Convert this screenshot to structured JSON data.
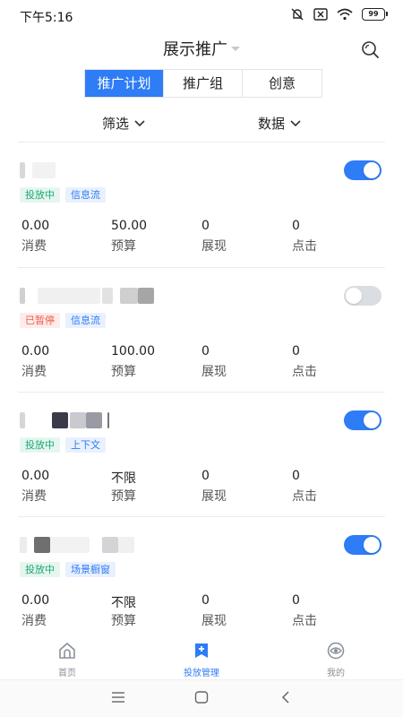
{
  "status_bar": {
    "time": "下午5:16",
    "battery": "99",
    "icons": [
      "alarm-off-icon",
      "sim-off-icon",
      "wifi-icon",
      "battery-icon"
    ]
  },
  "header": {
    "title": "展示推广",
    "search_icon": "search-icon"
  },
  "tabs": [
    {
      "label": "推广计划",
      "active": true
    },
    {
      "label": "推广组",
      "active": false
    },
    {
      "label": "创意",
      "active": false
    }
  ],
  "filters": {
    "filter_label": "筛选",
    "data_label": "数据"
  },
  "campaigns": [
    {
      "enabled": true,
      "tags": [
        {
          "text": "投放中",
          "style": "green"
        },
        {
          "text": "信息流",
          "style": "blue"
        }
      ],
      "metrics": [
        {
          "value": "0.00",
          "label": "消费"
        },
        {
          "value": "50.00",
          "label": "预算"
        },
        {
          "value": "0",
          "label": "展现"
        },
        {
          "value": "0",
          "label": "点击"
        }
      ]
    },
    {
      "enabled": false,
      "tags": [
        {
          "text": "已暂停",
          "style": "red"
        },
        {
          "text": "信息流",
          "style": "blue"
        }
      ],
      "metrics": [
        {
          "value": "0.00",
          "label": "消费"
        },
        {
          "value": "100.00",
          "label": "预算"
        },
        {
          "value": "0",
          "label": "展现"
        },
        {
          "value": "0",
          "label": "点击"
        }
      ]
    },
    {
      "enabled": true,
      "tags": [
        {
          "text": "投放中",
          "style": "green"
        },
        {
          "text": "上下文",
          "style": "blue"
        }
      ],
      "metrics": [
        {
          "value": "0.00",
          "label": "消费"
        },
        {
          "value": "不限",
          "label": "预算"
        },
        {
          "value": "0",
          "label": "展现"
        },
        {
          "value": "0",
          "label": "点击"
        }
      ]
    },
    {
      "enabled": true,
      "tags": [
        {
          "text": "投放中",
          "style": "green"
        },
        {
          "text": "场景橱窗",
          "style": "blue"
        }
      ],
      "metrics": [
        {
          "value": "0.00",
          "label": "消费"
        },
        {
          "value": "不限",
          "label": "预算"
        },
        {
          "value": "0",
          "label": "展现"
        },
        {
          "value": "0",
          "label": "点击"
        }
      ]
    }
  ],
  "bottom_nav": [
    {
      "label": "首页",
      "icon": "home-icon",
      "active": false
    },
    {
      "label": "投放管理",
      "icon": "campaign-manage-icon",
      "active": true
    },
    {
      "label": "我的",
      "icon": "profile-eye-icon",
      "active": false
    }
  ],
  "system_nav": [
    "menu-icon",
    "home-square-icon",
    "back-icon"
  ],
  "colors": {
    "accent": "#2e7cf6",
    "green_tag": "#19a974",
    "red_tag": "#f05a4a",
    "toggle_off": "#dadde2"
  }
}
